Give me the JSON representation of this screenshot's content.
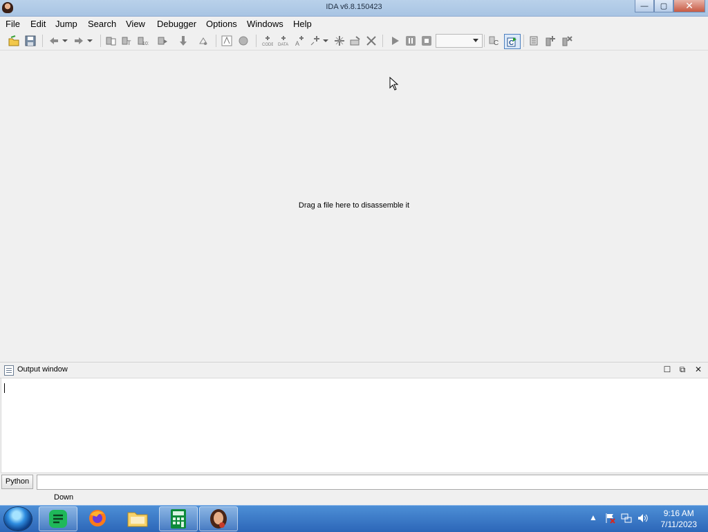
{
  "window": {
    "title": "IDA v6.8.150423",
    "controls": {
      "minimize": "—",
      "maximize": "▢",
      "close": "✕"
    }
  },
  "menu": {
    "items": [
      "File",
      "Edit",
      "Jump",
      "Search",
      "View",
      "Debugger",
      "Options",
      "Windows",
      "Help"
    ]
  },
  "toolbar": {
    "debugger_select": {
      "value": ""
    },
    "icons": [
      "open-icon",
      "save-icon",
      "back-icon",
      "back-dropdown-icon",
      "forward-icon",
      "forward-dropdown-icon",
      "text-search-icon",
      "search-text-icon",
      "search-immediate-icon",
      "search-next-icon",
      "jump-down-icon",
      "patch-icon",
      "text-mode-icon",
      "graph-icon",
      "make-code-icon",
      "make-data-icon",
      "make-ascii-icon",
      "make-array-icon",
      "add-function-icon",
      "undefine-icon",
      "delete-icon",
      "run-icon",
      "pause-icon",
      "stop-icon",
      "c-decompile-icon",
      "c-active-icon",
      "structs-icon",
      "breakpoint-icon",
      "breakpoint-remove-icon"
    ]
  },
  "workspace": {
    "hint": "Drag a file here to disassemble it"
  },
  "output": {
    "title": "Output window",
    "content": "",
    "controls": {
      "maximize": "☐",
      "float": "⧉",
      "close": "✕"
    }
  },
  "cli": {
    "language": "Python",
    "input_value": ""
  },
  "status": {
    "text": "Down"
  },
  "taskbar": {
    "apps": [
      "start-orb-icon",
      "sticky-notes-icon",
      "firefox-icon",
      "file-explorer-icon",
      "calculator-icon",
      "ida-icon"
    ],
    "tray": [
      "show-hidden-icons-icon",
      "action-center-icon",
      "network-icon",
      "volume-icon"
    ],
    "time": "9:16 AM",
    "date": "7/11/2023"
  }
}
